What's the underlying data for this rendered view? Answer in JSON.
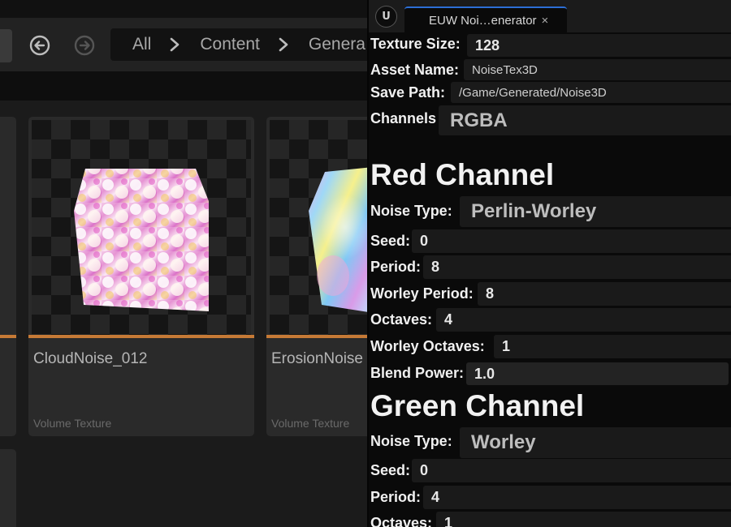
{
  "content_browser": {
    "breadcrumb": [
      "All",
      "Content",
      "Genera"
    ],
    "assets": [
      {
        "name": "CloudNoise_012",
        "type": "Volume Texture"
      },
      {
        "name": "ErosionNoise",
        "type": "Volume Texture"
      }
    ]
  },
  "widget": {
    "tab_label": "EUW Noi…enerator",
    "tab_close": "×",
    "logo": "U",
    "texture_size_label": "Texture Size:",
    "texture_size": "128",
    "asset_name_label": "Asset Name:",
    "asset_name": "NoiseTex3D",
    "save_path_label": "Save Path:",
    "save_path": "/Game/Generated/Noise3D",
    "channels_label": "Channels",
    "channels": "RGBA",
    "red": {
      "title": "Red Channel",
      "noise_type_label": "Noise Type:",
      "noise_type": "Perlin-Worley",
      "seed_label": "Seed:",
      "seed": "0",
      "period_label": "Period:",
      "period": "8",
      "worley_period_label": "Worley Period:",
      "worley_period": "8",
      "octaves_label": "Octaves:",
      "octaves": "4",
      "worley_octaves_label": "Worley Octaves:",
      "worley_octaves": "1",
      "blend_power_label": "Blend Power:",
      "blend_power": "1.0"
    },
    "green": {
      "title": "Green Channel",
      "noise_type_label": "Noise Type:",
      "noise_type": "Worley",
      "seed_label": "Seed:",
      "seed": "0",
      "period_label": "Period:",
      "period": "4",
      "octaves_label": "Octaves:",
      "octaves": "1"
    }
  },
  "colors": {
    "accent_tab": "#2c6fd6",
    "asset_bar": "#c67a36",
    "panel_bg": "#0a0a0a",
    "field_bg": "#1a1a1a"
  }
}
